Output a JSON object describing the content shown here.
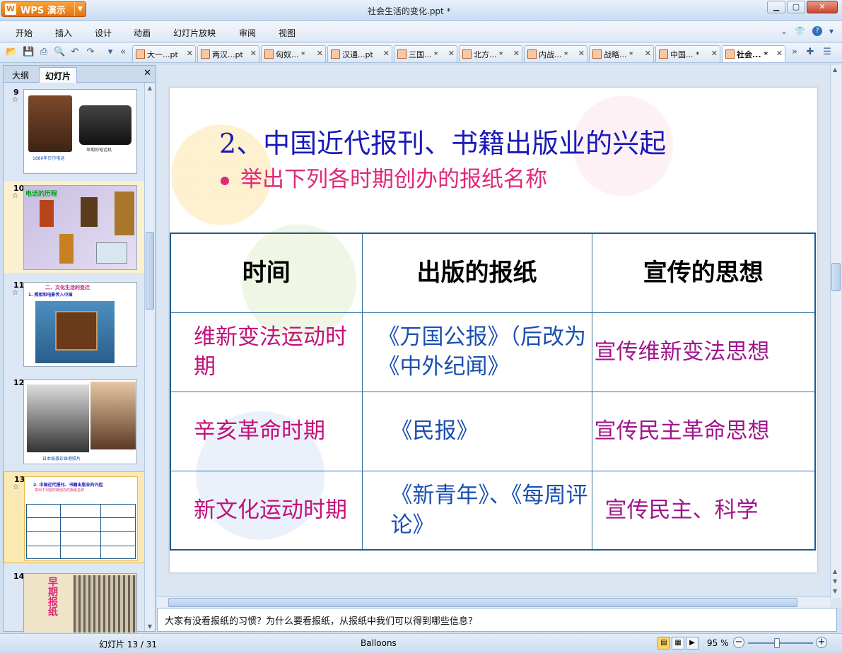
{
  "app": {
    "name": "WPS 演示",
    "window_title": "社会生活的变化.ppt *"
  },
  "menu": [
    "开始",
    "插入",
    "设计",
    "动画",
    "幻灯片放映",
    "审阅",
    "视图"
  ],
  "doc_tabs": [
    {
      "label": "大一...pt"
    },
    {
      "label": "两汉...pt"
    },
    {
      "label": "匈奴... *"
    },
    {
      "label": "汉通...pt"
    },
    {
      "label": "三国... *"
    },
    {
      "label": "北方... *"
    },
    {
      "label": "内战... *"
    },
    {
      "label": "战略... *"
    },
    {
      "label": "中国... *"
    },
    {
      "label": "社会... *",
      "active": true
    }
  ],
  "left_panel": {
    "tabs": [
      "大纲",
      "幻灯片"
    ],
    "thumbnails": [
      {
        "num": "9",
        "caption": "1880年贝尔电话",
        "caption2": "早期的电话机"
      },
      {
        "num": "10",
        "title": "电话的历程"
      },
      {
        "num": "11",
        "title": "二、文化生活的变迁",
        "subtitle": "1. 照相和电影传入中国"
      },
      {
        "num": "12",
        "caption": "日本偷袭珍珠港照片"
      },
      {
        "num": "13",
        "title": "2. 中国近代报刊、书籍出版业的兴起",
        "subtitle": "举出下列各时期创办的报纸名称"
      },
      {
        "num": "14",
        "title": "早期报纸"
      }
    ]
  },
  "slide": {
    "title": "2、中国近代报刊、书籍出版业的兴起",
    "bullet": "举出下列各时期创办的报纸名称",
    "table": {
      "headers": [
        "时间",
        "出版的报纸",
        "宣传的思想"
      ],
      "rows": [
        [
          "维新变法运动时期",
          "《万国公报》（后改为《中外纪闻》",
          "宣传维新变法思想"
        ],
        [
          "辛亥革命时期",
          "《民报》",
          "宣传民主革命思想"
        ],
        [
          "新文化运动时期",
          "《新青年》、《每周评论》",
          "宣传民主、科学"
        ]
      ]
    }
  },
  "notes": "大家有没看报纸的习惯？为什么要看报纸，从报纸中我们可以得到哪些信息？",
  "status": {
    "slide_counter": "幻灯片 13 / 31",
    "theme": "Balloons",
    "zoom": "95 %"
  }
}
